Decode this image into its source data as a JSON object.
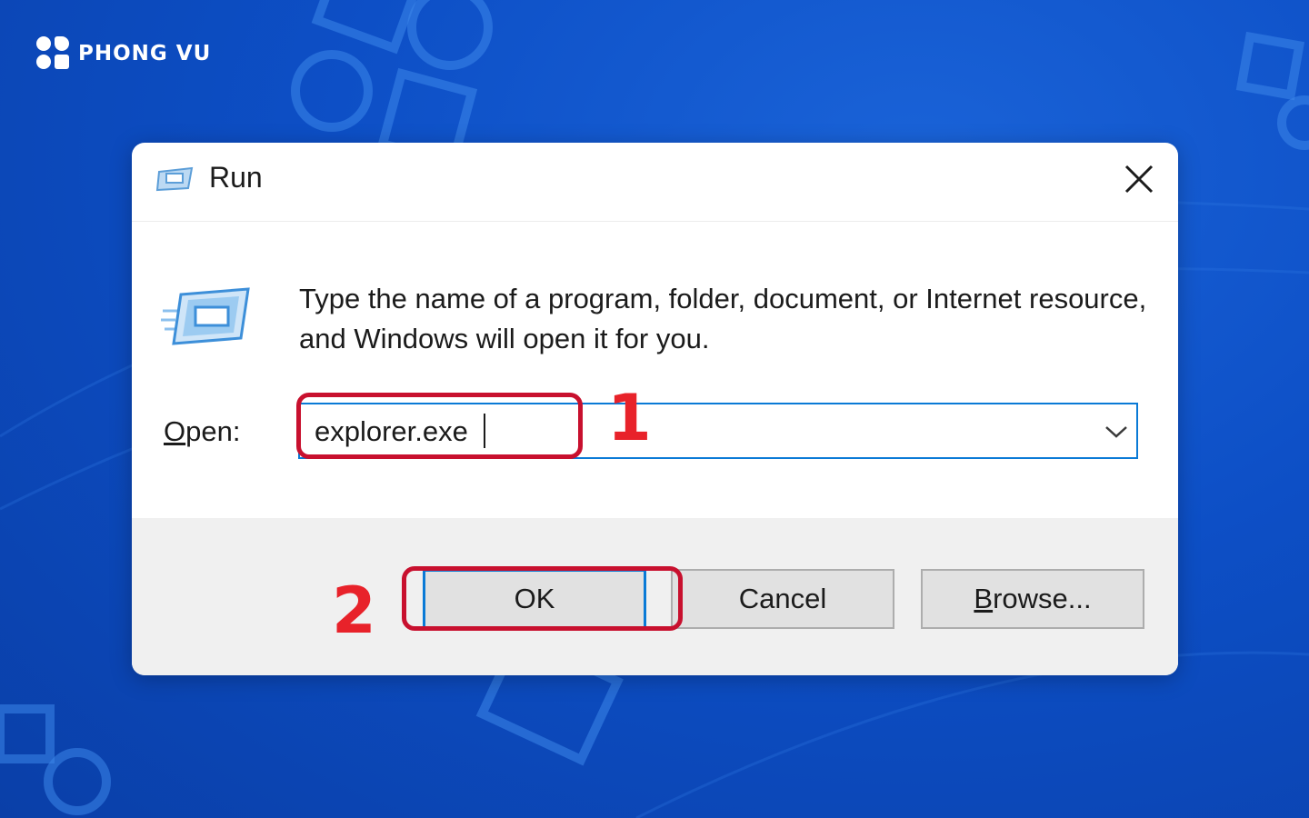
{
  "brand": {
    "name": "PHONG VU"
  },
  "dialog": {
    "title": "Run",
    "description": "Type the name of a program, folder, document, or Internet resource, and Windows will open it for you.",
    "open_label_mnemonic": "O",
    "open_label_rest": "pen:",
    "open_value": "explorer.exe",
    "buttons": {
      "ok": "OK",
      "cancel": "Cancel",
      "browse_mnemonic": "B",
      "browse_rest": "rowse..."
    }
  },
  "annotations": {
    "step1": "1",
    "step2": "2"
  },
  "icons": {
    "close": "close-icon",
    "run_small": "run-icon",
    "run_large": "run-large-icon",
    "dropdown": "chevron-down-icon"
  },
  "colors": {
    "background": "#0d4fc6",
    "annotation_box": "#c8102e",
    "annotation_number": "#e8222a",
    "focus_border": "#0a7ad6"
  }
}
